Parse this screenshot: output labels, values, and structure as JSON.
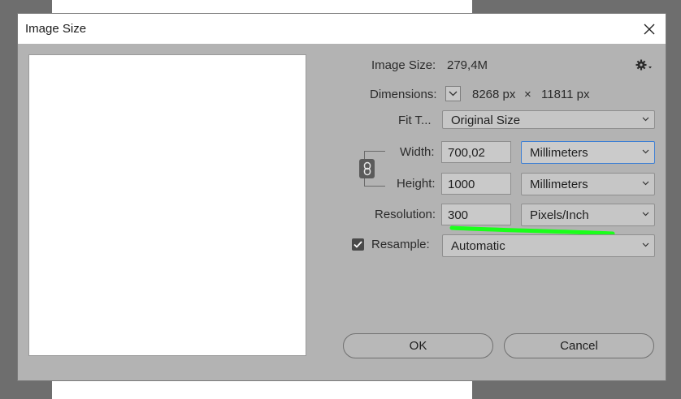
{
  "dialog": {
    "title": "Image Size"
  },
  "image_size": {
    "label": "Image Size:",
    "value": "279,4M"
  },
  "dimensions": {
    "label": "Dimensions:",
    "width": "8268 px",
    "separator": "×",
    "height": "11811 px"
  },
  "fit_to": {
    "label": "Fit T...",
    "selected": "Original Size"
  },
  "width": {
    "label": "Width:",
    "value": "700,02",
    "unit": "Millimeters"
  },
  "height": {
    "label": "Height:",
    "value": "1000",
    "unit": "Millimeters"
  },
  "resolution": {
    "label": "Resolution:",
    "value": "300",
    "unit": "Pixels/Inch"
  },
  "resample": {
    "label": "Resample:",
    "checked": true,
    "selected": "Automatic"
  },
  "buttons": {
    "ok": "OK",
    "cancel": "Cancel"
  },
  "icons": {
    "close": "close-icon",
    "gear": "gear-icon",
    "chain": "link-icon",
    "chevron": "chevron-down-icon"
  },
  "colors": {
    "dialog_bg": "#b3b3b3",
    "highlight_mark": "#1aff1a",
    "active_border": "#3d7fd4"
  }
}
